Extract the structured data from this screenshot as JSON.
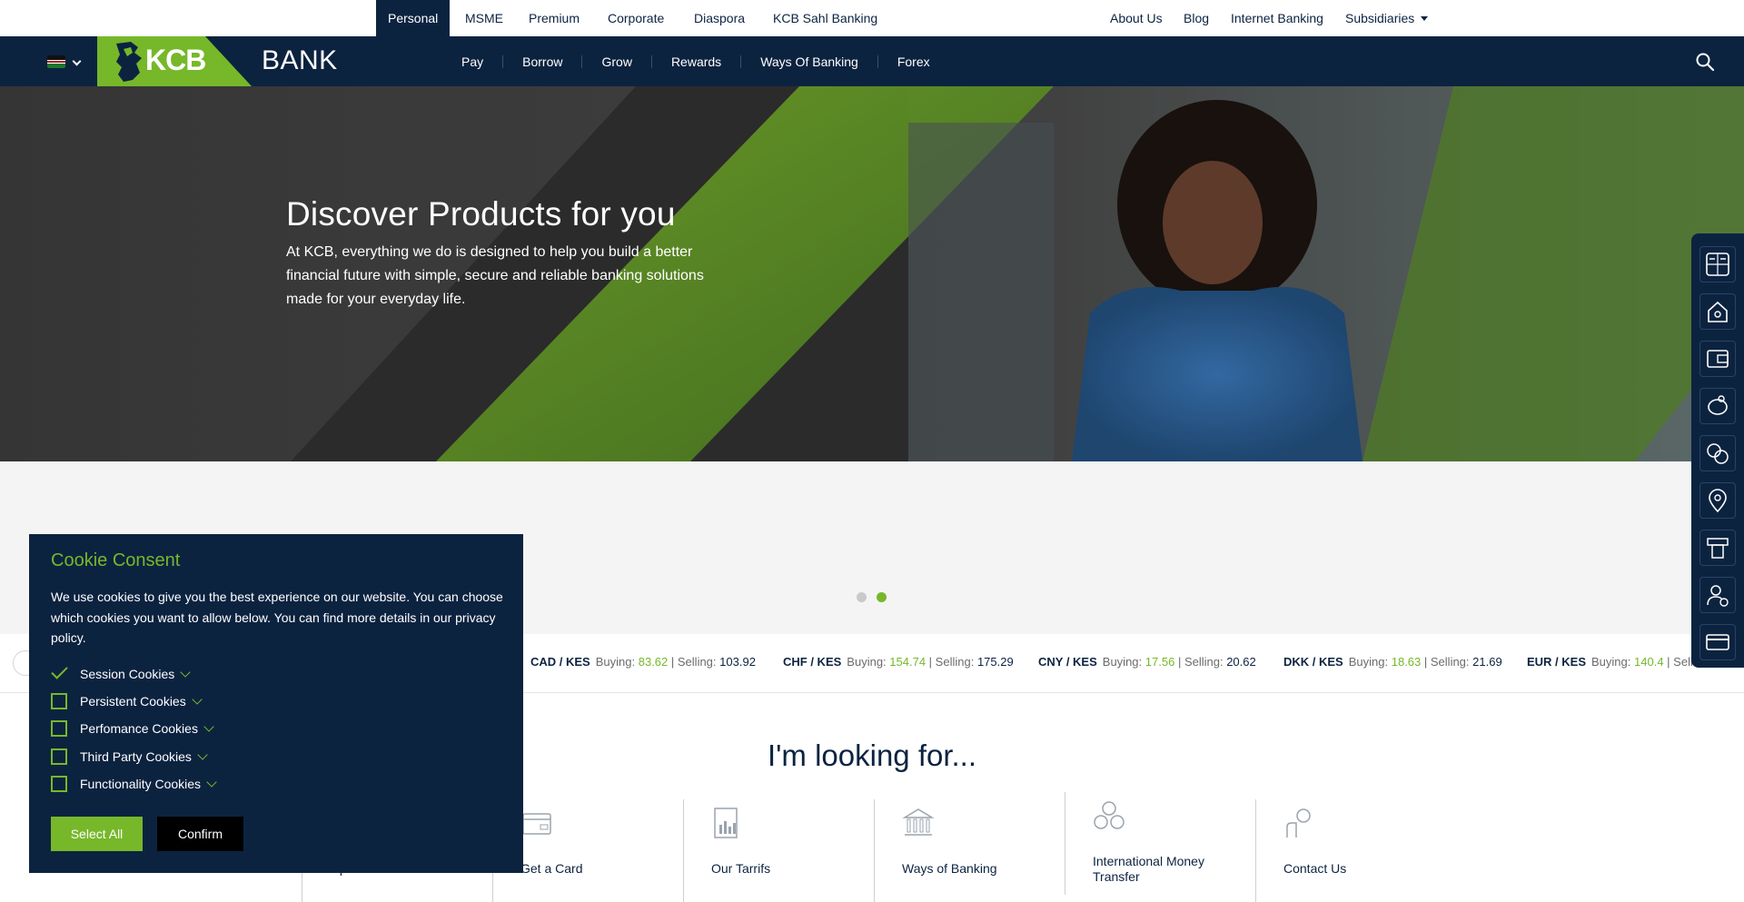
{
  "topbar": {
    "segments": [
      "Personal",
      "MSME",
      "Premium",
      "Corporate",
      "Diaspora",
      "KCB Sahl Banking"
    ],
    "right_links": [
      "About Us",
      "Blog",
      "Internet Banking",
      "Subsidiaries"
    ]
  },
  "nav": {
    "logo_text": "KCB",
    "logo_suffix": "BANK",
    "links": [
      "Pay",
      "Borrow",
      "Grow",
      "Rewards",
      "Ways Of Banking",
      "Forex"
    ],
    "icons": [
      "kenya-flag-icon",
      "chevron-down-icon",
      "search-icon"
    ]
  },
  "hero": {
    "title": "Discover Products for you",
    "text": "At KCB, everything we do is designed to help you build a better financial future with simple, secure and reliable banking solutions made for your everyday life."
  },
  "carousel": {
    "total_slides": 2,
    "active_slide": 2
  },
  "forex": {
    "buying_label": "Buying:",
    "selling_label": "Selling:",
    "rates": [
      {
        "pair": "CAD / KES",
        "buying": "83.62",
        "selling": "103.92"
      },
      {
        "pair": "CHF / KES",
        "buying": "154.74",
        "selling": "175.29"
      },
      {
        "pair": "CNY / KES",
        "buying": "17.56",
        "selling": "20.62"
      },
      {
        "pair": "DKK / KES",
        "buying": "18.63",
        "selling": "21.69"
      },
      {
        "pair": "EUR / KES",
        "buying": "140.4",
        "selling": "Sellin"
      }
    ]
  },
  "looking_for": {
    "title": "I'm looking for...",
    "items": [
      {
        "label": "Open Accoun",
        "icon": "account-icon"
      },
      {
        "label": "Get a Card",
        "icon": "card-icon"
      },
      {
        "label": "Our Tarrifs",
        "icon": "tariffs-icon"
      },
      {
        "label": "Ways of Banking",
        "icon": "bank-icon"
      },
      {
        "label": "International Money Transfer",
        "icon": "money-transfer-icon"
      },
      {
        "label": "Contact Us",
        "icon": "contact-icon"
      }
    ]
  },
  "sidebar": {
    "icons": [
      "calculator-icon",
      "home-loan-icon",
      "wallet-icon",
      "piggy-bank-icon",
      "currency-exchange-icon",
      "location-icon",
      "atm-icon",
      "user-check-icon",
      "credit-card-icon"
    ]
  },
  "cookie": {
    "title": "Cookie Consent",
    "text": "We use cookies to give you the best experience on our website. You can choose which cookies you want to allow below. You can find more details in our privacy policy.",
    "options": [
      {
        "label": "Session Cookies",
        "checked": true
      },
      {
        "label": "Persistent Cookies",
        "checked": false
      },
      {
        "label": "Perfomance Cookies",
        "checked": false
      },
      {
        "label": "Third Party Cookies",
        "checked": false
      },
      {
        "label": "Functionality Cookies",
        "checked": false
      }
    ],
    "select_all_label": "Select All",
    "confirm_label": "Confirm"
  },
  "colors": {
    "navy": "#0c2340",
    "green": "#76b82a",
    "grey_bg": "#f4f4f4"
  }
}
